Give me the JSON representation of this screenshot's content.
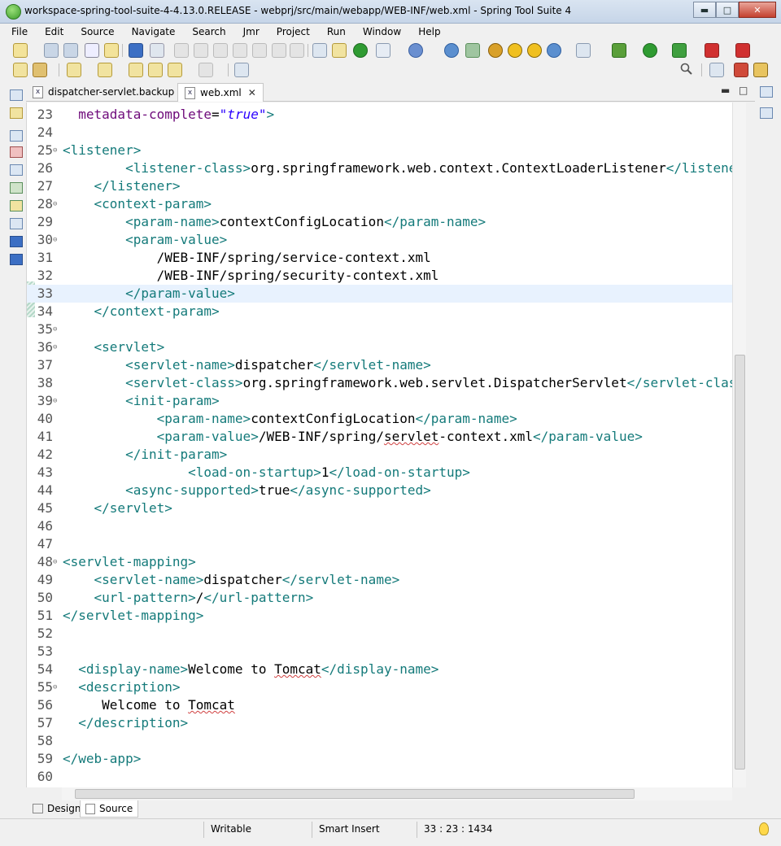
{
  "window": {
    "title": "workspace-spring-tool-suite-4-4.13.0.RELEASE - webprj/src/main/webapp/WEB-INF/web.xml - Spring Tool Suite 4",
    "minimize": "▬",
    "maximize": "□",
    "close": "✕"
  },
  "menu": [
    "File",
    "Edit",
    "Source",
    "Navigate",
    "Search",
    "Jmr",
    "Project",
    "Run",
    "Window",
    "Help"
  ],
  "tabs": [
    {
      "label": "dispatcher-servlet.backup",
      "active": false
    },
    {
      "label": "web.xml",
      "active": true
    }
  ],
  "tab_close": "✕",
  "editor_minimize": "▬",
  "editor_maximize": "□",
  "lines": [
    {
      "n": "23",
      "fold": "",
      "code": [
        [
          "t",
          "  "
        ],
        [
          "n",
          "metadata-complete"
        ],
        [
          "x",
          "="
        ],
        [
          "v",
          "\"true\""
        ],
        [
          "t",
          ">"
        ]
      ]
    },
    {
      "n": "24",
      "fold": "",
      "code": []
    },
    {
      "n": "25",
      "fold": "⊖",
      "code": [
        [
          "t",
          "<listener>"
        ]
      ]
    },
    {
      "n": "26",
      "fold": "",
      "code": [
        [
          "t",
          "        <listener-class>"
        ],
        [
          "x",
          "org.springframework.web.context.ContextLoaderListener"
        ],
        [
          "t",
          "</listener-class>"
        ]
      ]
    },
    {
      "n": "27",
      "fold": "",
      "code": [
        [
          "t",
          "    </listener>"
        ]
      ]
    },
    {
      "n": "28",
      "fold": "⊖",
      "code": [
        [
          "t",
          "    <context-param>"
        ]
      ]
    },
    {
      "n": "29",
      "fold": "",
      "code": [
        [
          "t",
          "        <param-name>"
        ],
        [
          "x",
          "contextConfigLocation"
        ],
        [
          "t",
          "</param-name>"
        ]
      ]
    },
    {
      "n": "30",
      "fold": "⊖",
      "code": [
        [
          "t",
          "        <param-value>"
        ]
      ]
    },
    {
      "n": "31",
      "fold": "",
      "code": [
        [
          "x",
          "            /WEB-INF/spring/service-context.xml"
        ]
      ]
    },
    {
      "n": "32",
      "fold": "",
      "code": [
        [
          "x",
          "            /WEB-INF/spring/security-context.xml"
        ]
      ]
    },
    {
      "n": "33",
      "fold": "",
      "code": [
        [
          "t",
          "        </param-value>"
        ]
      ]
    },
    {
      "n": "34",
      "fold": "",
      "code": [
        [
          "t",
          "    </context-param>"
        ]
      ]
    },
    {
      "n": "35",
      "fold": "⊖",
      "code": []
    },
    {
      "n": "36",
      "fold": "⊖",
      "code": [
        [
          "t",
          "    <servlet>"
        ]
      ]
    },
    {
      "n": "37",
      "fold": "",
      "code": [
        [
          "t",
          "        <servlet-name>"
        ],
        [
          "x",
          "dispatcher"
        ],
        [
          "t",
          "</servlet-name>"
        ]
      ]
    },
    {
      "n": "38",
      "fold": "",
      "code": [
        [
          "t",
          "        <servlet-class>"
        ],
        [
          "x",
          "org.springframework.web.servlet.DispatcherServlet"
        ],
        [
          "t",
          "</servlet-class>"
        ]
      ]
    },
    {
      "n": "39",
      "fold": "⊖",
      "code": [
        [
          "t",
          "        <init-param>"
        ]
      ]
    },
    {
      "n": "40",
      "fold": "",
      "code": [
        [
          "t",
          "            <param-name>"
        ],
        [
          "x",
          "contextConfigLocation"
        ],
        [
          "t",
          "</param-name>"
        ]
      ]
    },
    {
      "n": "41",
      "fold": "",
      "code": [
        [
          "t",
          "            <param-value>"
        ],
        [
          "x",
          "/WEB-INF/spring/"
        ],
        [
          "xs",
          "servlet"
        ],
        [
          "x",
          "-context.xml"
        ],
        [
          "t",
          "</param-value>"
        ]
      ]
    },
    {
      "n": "42",
      "fold": "",
      "code": [
        [
          "t",
          "        </init-param>"
        ]
      ]
    },
    {
      "n": "43",
      "fold": "",
      "code": [
        [
          "t",
          "                <load-on-startup>"
        ],
        [
          "x",
          "1"
        ],
        [
          "t",
          "</load-on-startup>"
        ]
      ]
    },
    {
      "n": "44",
      "fold": "",
      "code": [
        [
          "t",
          "        <async-supported>"
        ],
        [
          "x",
          "true"
        ],
        [
          "t",
          "</async-supported>"
        ]
      ]
    },
    {
      "n": "45",
      "fold": "",
      "code": [
        [
          "t",
          "    </servlet>"
        ]
      ]
    },
    {
      "n": "46",
      "fold": "",
      "code": []
    },
    {
      "n": "47",
      "fold": "",
      "code": []
    },
    {
      "n": "48",
      "fold": "⊖",
      "code": [
        [
          "t",
          "<servlet-mapping>"
        ]
      ]
    },
    {
      "n": "49",
      "fold": "",
      "code": [
        [
          "t",
          "    <servlet-name>"
        ],
        [
          "x",
          "dispatcher"
        ],
        [
          "t",
          "</servlet-name>"
        ]
      ]
    },
    {
      "n": "50",
      "fold": "",
      "code": [
        [
          "t",
          "    <url-pattern>"
        ],
        [
          "x",
          "/"
        ],
        [
          "t",
          "</url-pattern>"
        ]
      ]
    },
    {
      "n": "51",
      "fold": "",
      "code": [
        [
          "t",
          "</servlet-mapping>"
        ]
      ]
    },
    {
      "n": "52",
      "fold": "",
      "code": []
    },
    {
      "n": "53",
      "fold": "",
      "code": []
    },
    {
      "n": "54",
      "fold": "",
      "code": [
        [
          "t",
          "  <display-name>"
        ],
        [
          "x",
          "Welcome to "
        ],
        [
          "xs",
          "Tomcat"
        ],
        [
          "t",
          "</display-name>"
        ]
      ]
    },
    {
      "n": "55",
      "fold": "⊖",
      "code": [
        [
          "t",
          "  <description>"
        ]
      ]
    },
    {
      "n": "56",
      "fold": "",
      "code": [
        [
          "x",
          "     Welcome to "
        ],
        [
          "xs",
          "Tomcat"
        ]
      ]
    },
    {
      "n": "57",
      "fold": "",
      "code": [
        [
          "t",
          "  </description>"
        ]
      ]
    },
    {
      "n": "58",
      "fold": "",
      "code": []
    },
    {
      "n": "59",
      "fold": "",
      "code": [
        [
          "t",
          "</web-app>"
        ]
      ]
    },
    {
      "n": "60",
      "fold": "",
      "code": []
    }
  ],
  "current_line": "33",
  "page_tabs": {
    "design": "Design",
    "source": "Source"
  },
  "status": {
    "mode": "Writable",
    "insert": "Smart Insert",
    "position": "33 : 23 : 1434"
  },
  "colors": {
    "tag": "#147a7a",
    "attribute": "#6e0a7a",
    "string": "#2a00ff",
    "current_line": "#e8f2fe"
  }
}
